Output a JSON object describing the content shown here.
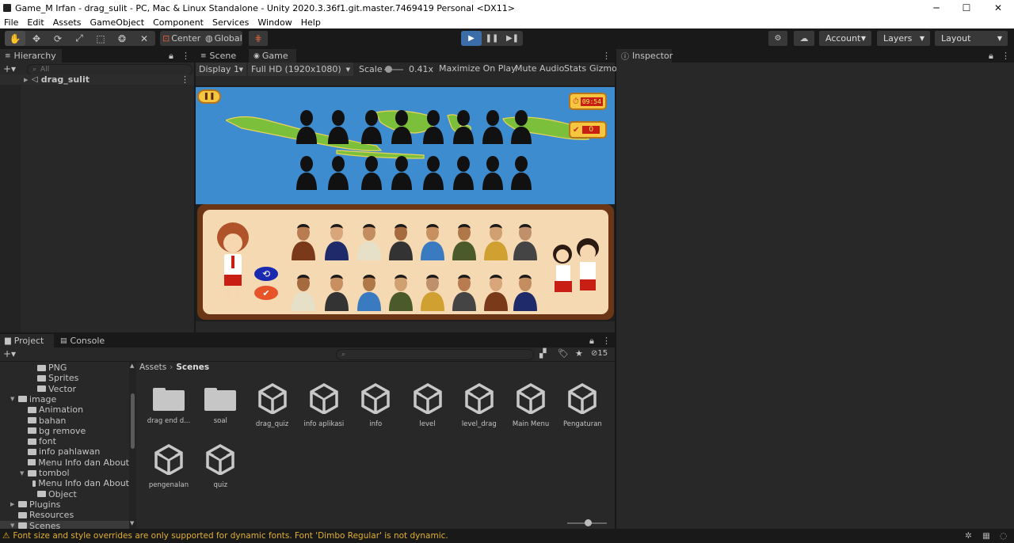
{
  "window": {
    "title": "Game_M Irfan - drag_sulit - PC, Mac & Linux Standalone - Unity 2020.3.36f1.git.master.7469419 Personal <DX11>",
    "minimize": "─",
    "maximize": "☐",
    "close": "✕"
  },
  "menu": [
    "File",
    "Edit",
    "Assets",
    "GameObject",
    "Component",
    "Services",
    "Window",
    "Help"
  ],
  "toolbar": {
    "pivot_label": "Center",
    "space_label": "Global",
    "account_label": "Account",
    "layers_label": "Layers",
    "layout_label": "Layout"
  },
  "hierarchy": {
    "tab": "Hierarchy",
    "search_placeholder": "All",
    "root_item": "drag_sulit"
  },
  "scene_tab": "Scene",
  "game": {
    "tab": "Game",
    "display": "Display 1",
    "resolution": "Full HD (1920x1080)",
    "scale_label": "Scale",
    "scale_value": "0.41x",
    "maximize_on_play": "Maximize On Play",
    "mute_audio": "Mute Audio",
    "stats": "Stats",
    "gizmos": "Gizmo",
    "hud": {
      "timer": "09:54",
      "score": "0",
      "pause_icon": "pause-icon"
    }
  },
  "inspector": {
    "tab": "Inspector"
  },
  "project": {
    "tab": "Project",
    "console_tab": "Console",
    "hidden_count": "15",
    "breadcrumb": [
      "Assets",
      "Scenes"
    ],
    "tree": [
      {
        "label": "PNG",
        "depth": 3,
        "arrow": ""
      },
      {
        "label": "Sprites",
        "depth": 3,
        "arrow": ""
      },
      {
        "label": "Vector",
        "depth": 3,
        "arrow": ""
      },
      {
        "label": "image",
        "depth": 1,
        "arrow": "▼"
      },
      {
        "label": "Animation",
        "depth": 2,
        "arrow": ""
      },
      {
        "label": "bahan",
        "depth": 2,
        "arrow": ""
      },
      {
        "label": "bg remove",
        "depth": 2,
        "arrow": ""
      },
      {
        "label": "font",
        "depth": 2,
        "arrow": ""
      },
      {
        "label": "info pahlawan",
        "depth": 2,
        "arrow": ""
      },
      {
        "label": "Menu Info dan About",
        "depth": 2,
        "arrow": ""
      },
      {
        "label": "tombol",
        "depth": 2,
        "arrow": "▼"
      },
      {
        "label": "Menu Info dan About",
        "depth": 3,
        "arrow": ""
      },
      {
        "label": "Object",
        "depth": 3,
        "arrow": ""
      },
      {
        "label": "Plugins",
        "depth": 1,
        "arrow": "▶"
      },
      {
        "label": "Resources",
        "depth": 1,
        "arrow": ""
      },
      {
        "label": "Scenes",
        "depth": 1,
        "arrow": "▼"
      }
    ],
    "assets": [
      {
        "label": "drag end d...",
        "kind": "folder"
      },
      {
        "label": "soal",
        "kind": "folder"
      },
      {
        "label": "drag_quiz",
        "kind": "scene"
      },
      {
        "label": "info aplikasi",
        "kind": "scene"
      },
      {
        "label": "info",
        "kind": "scene"
      },
      {
        "label": "level",
        "kind": "scene"
      },
      {
        "label": "level_drag",
        "kind": "scene"
      },
      {
        "label": "Main Menu",
        "kind": "scene"
      },
      {
        "label": "Pengaturan",
        "kind": "scene"
      },
      {
        "label": "pengenalan",
        "kind": "scene"
      },
      {
        "label": "quiz",
        "kind": "scene"
      }
    ]
  },
  "status": {
    "message": "Font size and style overrides are only supported for dynamic fonts. Font 'Dimbo Regular' is not dynamic."
  }
}
